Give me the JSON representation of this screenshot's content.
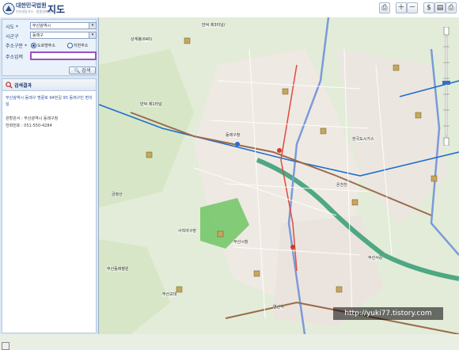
{
  "header": {
    "brand": "대한민국법원",
    "brand_sub": "인터넷등기소 · 법원경매정보",
    "title": "지도"
  },
  "search": {
    "sido_label": "시도 *",
    "sido_value": "부산광역시",
    "sigungu_label": "시군구",
    "sigungu_value": "동래구",
    "addr_type_label": "주소구분 *",
    "addr_type_options": [
      "도로명주소",
      "지번주소"
    ],
    "addr_label": "주소입력",
    "addr_value": "",
    "button": "검색"
  },
  "results": {
    "title": "검색결과",
    "address": "부산광역시 동래구 명륜로 94번길 95 동래구민 편의실",
    "manager": "관할관서 : 부산광역시 동래구청",
    "phone": "전화번호 : 051-550-4284"
  },
  "map_labels": [
    {
      "text": "상계봉(640)"
    },
    {
      "text": "만덕 제3터널/"
    },
    {
      "text": "만덕 제1터널"
    },
    {
      "text": "금정산"
    },
    {
      "text": "온천천"
    },
    {
      "text": "동래구청"
    },
    {
      "text": "부산시청"
    },
    {
      "text": "사직야구장"
    },
    {
      "text": "부산교대"
    },
    {
      "text": "연산역"
    },
    {
      "text": "부산동래병원"
    },
    {
      "text": "한국도시가스"
    },
    {
      "text": "부산서중"
    }
  ],
  "colors": {
    "accent": "#1f4c94",
    "input_border": "#9b4fc7",
    "map_bg": "#e9efe3"
  },
  "watermark": "http://yuki77.tistory.com"
}
